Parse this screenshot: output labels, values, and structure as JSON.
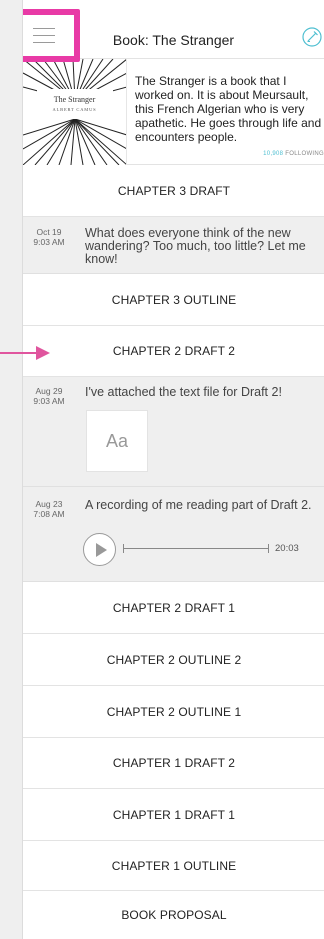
{
  "header": {
    "title": "Book: The Stranger"
  },
  "book": {
    "cover_title": "The Stranger",
    "cover_author": "ALBERT CAMUS",
    "description": "The Stranger is a book that I worked on. It is about Meursault, this French Algerian who is very apathetic. He goes through life and encounters people.",
    "followers_count": "10,908",
    "followers_label": "FOLLOWING"
  },
  "rows": {
    "ch3_draft": "CHAPTER 3 DRAFT",
    "ch3_outline": "CHAPTER 3 OUTLINE",
    "ch2_draft2": "CHAPTER 2 DRAFT 2",
    "ch2_draft1": "CHAPTER 2 DRAFT 1",
    "ch2_outline2": "CHAPTER 2 OUTLINE 2",
    "ch2_outline1": "CHAPTER 2 OUTLINE 1",
    "ch1_draft2": "CHAPTER 1 DRAFT 2",
    "ch1_draft1": "CHAPTER 1 DRAFT 1",
    "ch1_outline": "CHAPTER 1 OUTLINE",
    "proposal": "BOOK PROPOSAL"
  },
  "comments": [
    {
      "date": "Oct 19",
      "time": "9:03 AM",
      "text": "What does everyone think of the new wandering? Too much, too little? Let me know!"
    },
    {
      "date": "Aug 29",
      "time": "9:03 AM",
      "text": "I've attached the text file for Draft 2!",
      "attachment_label": "Aa"
    },
    {
      "date": "Aug 23",
      "time": "7:08 AM",
      "text": "A recording of me reading part of Draft 2.",
      "duration": "20:03"
    }
  ],
  "colors": {
    "highlight": "#e83aa6",
    "accent": "#4fbfd1",
    "comment_bg": "#efefef"
  },
  "icons": {
    "menu": "hamburger-menu-icon",
    "edit": "edit-pencil-icon",
    "play": "play-icon",
    "arrow": "pointer-arrow-icon"
  }
}
